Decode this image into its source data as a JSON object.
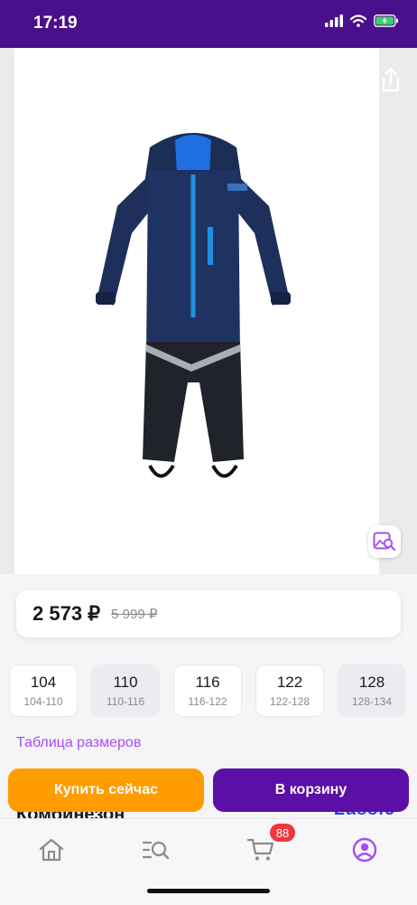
{
  "status_bar": {
    "time": "17:19",
    "icons": [
      "signal-icon",
      "wifi-icon",
      "battery-charging-icon"
    ],
    "background": "#4a0f8a"
  },
  "product": {
    "price_current": "2 573 ₽",
    "price_old": "5 999 ₽",
    "title_partial": "Комбинезон",
    "brand_partial": "Lassie"
  },
  "sizes": [
    {
      "size": "104",
      "range": "104-110"
    },
    {
      "size": "110",
      "range": "110-116"
    },
    {
      "size": "116",
      "range": "116-122"
    },
    {
      "size": "122",
      "range": "122-128"
    },
    {
      "size": "128",
      "range": "128-134"
    }
  ],
  "size_table_label": "Таблица размеров",
  "actions": {
    "buy_now": "Купить сейчас",
    "add_to_cart": "В корзину"
  },
  "tab_bar": {
    "cart_badge": "88"
  },
  "colors": {
    "accent_purple": "#5b0fa7",
    "buy_orange": "#ff9c00",
    "link_purple": "#a54ef0",
    "badge_red": "#f0373c"
  }
}
